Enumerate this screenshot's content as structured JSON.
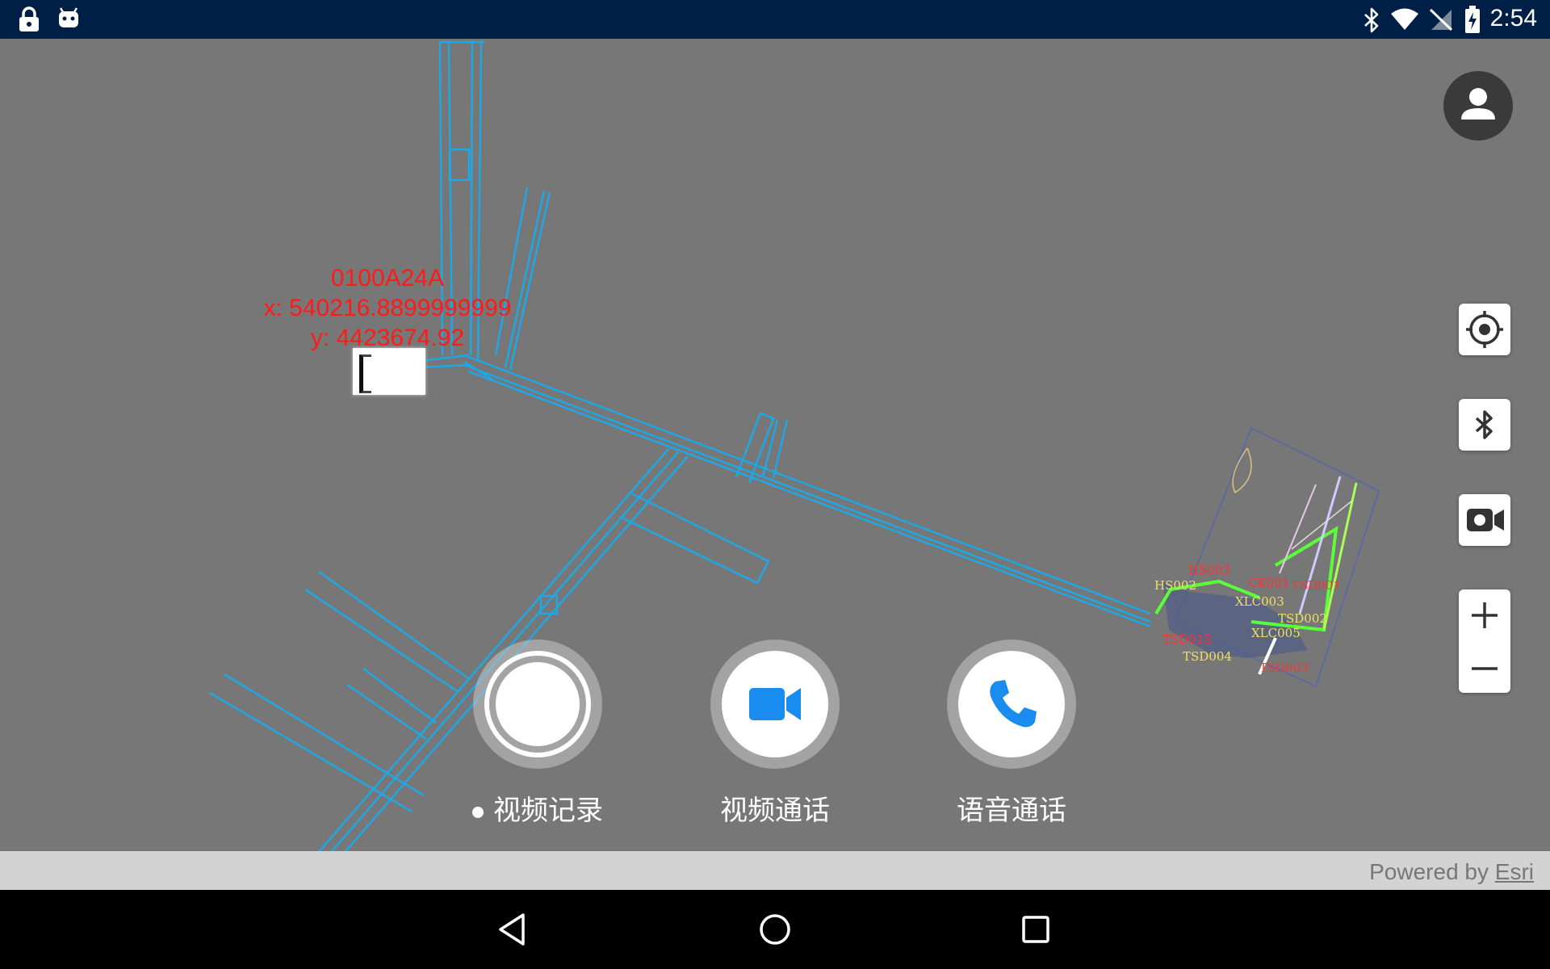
{
  "status_bar": {
    "time": "2:54",
    "left_icons": [
      "lock-icon",
      "android-icon"
    ],
    "right_icons": [
      "bluetooth-icon",
      "wifi-icon",
      "no-signal-icon",
      "battery-charging-icon"
    ]
  },
  "map": {
    "feature_label": {
      "id": "0100A24A",
      "x": "x: 540216.8899999999",
      "y": "y: 4423674.92"
    },
    "overlay_labels": [
      "HS003",
      "HS002",
      "CK001",
      "TSD001",
      "XLC003",
      "TSD002",
      "XLC005",
      "TSD015",
      "TSD004",
      "TSD003"
    ],
    "line_color": "#1ea8e6",
    "background_color": "#777777"
  },
  "controls": {
    "icons": [
      "account-icon",
      "locate-icon",
      "bluetooth-icon",
      "video-camera-icon",
      "zoom-in-icon",
      "zoom-out-icon"
    ]
  },
  "actions": {
    "record_label": "视频记录",
    "video_call_label": "视频通话",
    "voice_call_label": "语音通话",
    "accent": "#1a8cf0"
  },
  "attribution": {
    "prefix": "Powered by ",
    "link": "Esri"
  },
  "nav_bar": {
    "icons": [
      "back-icon",
      "home-icon",
      "recents-icon"
    ]
  }
}
